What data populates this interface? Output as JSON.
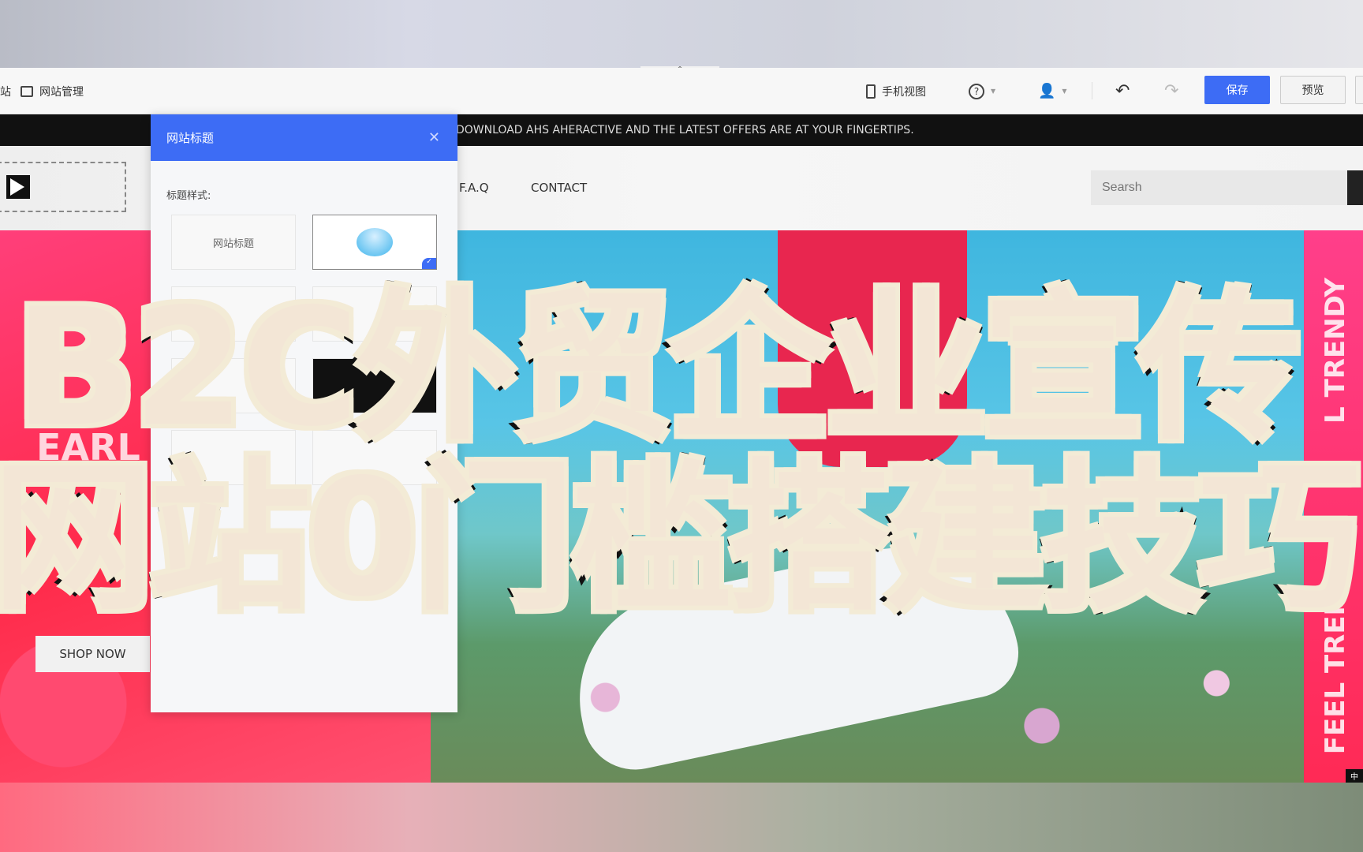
{
  "toolbar": {
    "site_label": "站",
    "manage_label": "网站管理",
    "mobile_view": "手机视图",
    "save": "保存",
    "preview": "预览",
    "collapse": "^"
  },
  "announcement": "DOWNLOAD AHS AHERACTIVE AND THE LATEST OFFERS ARE AT YOUR FINGERTIPS.",
  "nav": {
    "links": [
      "F.A.Q",
      "CONTACT"
    ],
    "search_placeholder": "Searsh"
  },
  "hero": {
    "left_text": "EARL",
    "shop_now": "SHOP NOW",
    "side_text_top": "L TRENDY",
    "side_text_bottom": "FEEL TREN",
    "lang": "中"
  },
  "panel": {
    "title": "网站标题",
    "style_label": "标题样式:",
    "card_text": "网站标题"
  },
  "overlay": {
    "line1": "B2C外贸企业宣传",
    "line2": "网站0门槛搭建技巧"
  },
  "colors": {
    "accent": "#3d6cf5",
    "hero_pink": "#ff2a55",
    "announce_bg": "#111111"
  }
}
